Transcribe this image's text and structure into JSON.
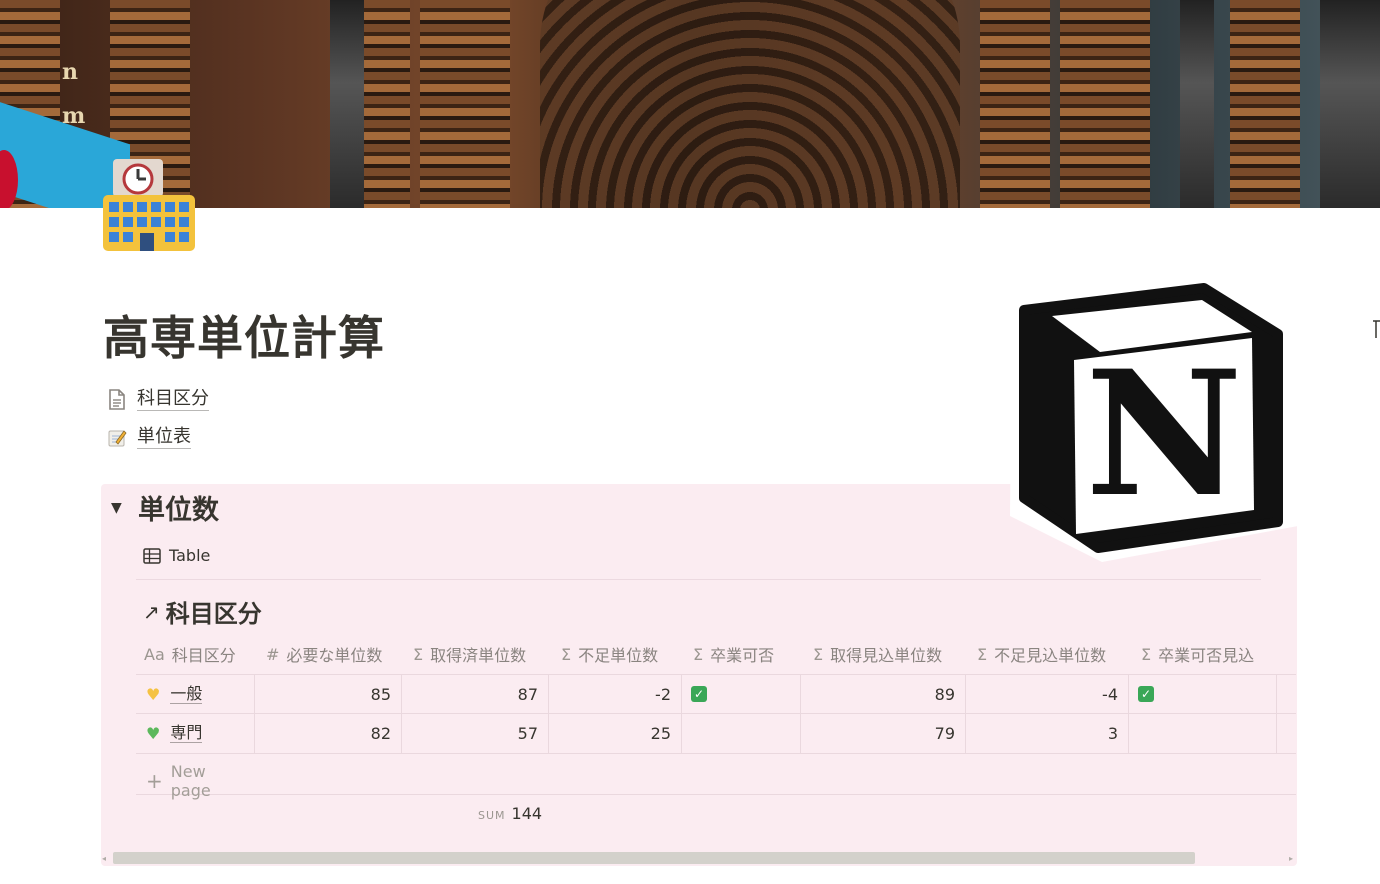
{
  "page": {
    "title": "高専単位計算",
    "icon": "school-building-icon"
  },
  "links": [
    {
      "label": "科目区分",
      "icon": "page-doc-icon"
    },
    {
      "label": "単位表",
      "icon": "memo-icon"
    }
  ],
  "section": {
    "heading": "単位数",
    "view_tab": "Table",
    "db_title": "科目区分",
    "db_link_icon": "arrow-up-right-icon"
  },
  "table": {
    "columns": [
      {
        "icon": "Aa",
        "label": "科目区分"
      },
      {
        "icon": "#",
        "label": "必要な単位数"
      },
      {
        "icon": "Σ",
        "label": "取得済単位数"
      },
      {
        "icon": "Σ",
        "label": "不足単位数"
      },
      {
        "icon": "Σ",
        "label": "卒業可否"
      },
      {
        "icon": "Σ",
        "label": "取得見込単位数"
      },
      {
        "icon": "Σ",
        "label": "不足見込単位数"
      },
      {
        "icon": "Σ",
        "label": "卒業可否見込"
      }
    ],
    "rows": [
      {
        "icon": "yellow-heart-icon",
        "name": "一般",
        "required": "85",
        "earned": "87",
        "shortfall": "-2",
        "graduate": true,
        "expected": "89",
        "expected_shortfall": "-4",
        "expected_graduate": true
      },
      {
        "icon": "green-heart-icon",
        "name": "専門",
        "required": "82",
        "earned": "57",
        "shortfall": "25",
        "graduate": false,
        "expected": "79",
        "expected_shortfall": "3",
        "expected_graduate": false
      }
    ],
    "new_page": "New page",
    "sum_label": "SUM",
    "sum_value": "144"
  },
  "colors": {
    "callout_bg": "#fbecf1",
    "text": "#37352f",
    "check_green": "#3aa757"
  }
}
